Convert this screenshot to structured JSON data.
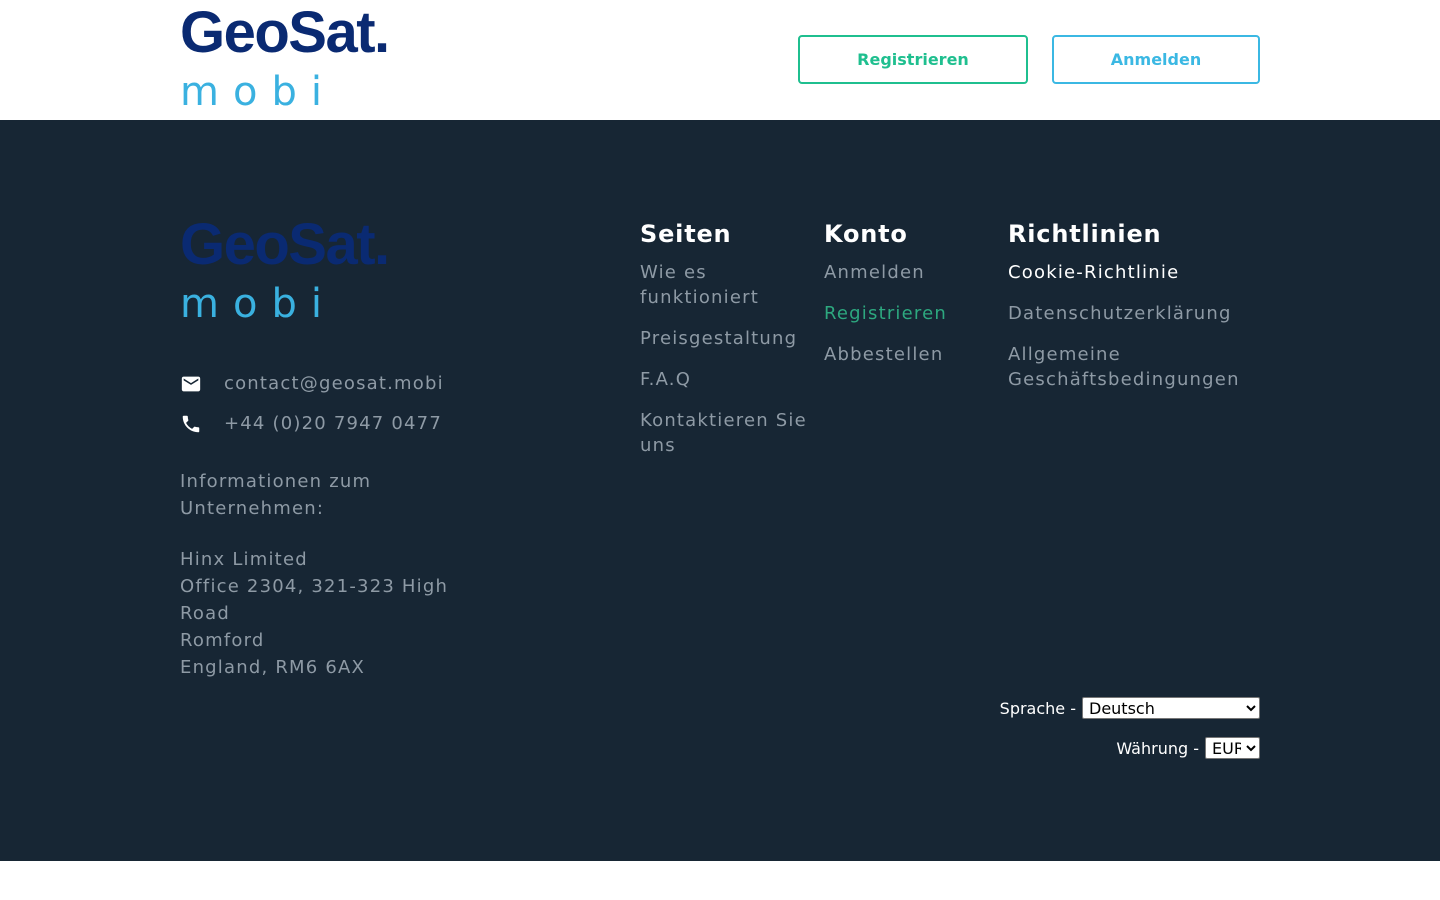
{
  "colors": {
    "footer_bg": "#172634",
    "logo_dark": "#0a2a72",
    "logo_light": "#3ab1e0",
    "accent_green": "#1fbf8f",
    "accent_cyan": "#3bb8e3",
    "link_muted": "#8e9aa5",
    "link_active": "#2da87f",
    "heading": "#ffffff"
  },
  "header": {
    "logo": {
      "word": "GeoSat.",
      "sub": "mobi"
    },
    "register_label": "Registrieren",
    "login_label": "Anmelden"
  },
  "footer": {
    "logo": {
      "word": "GeoSat.",
      "sub": "mobi"
    },
    "contact": {
      "email": "contact@geosat.mobi",
      "email_icon": "mail-icon",
      "phone": "+44 (0)20 7947 0477",
      "phone_icon": "phone-icon"
    },
    "company": {
      "title_line1": "Informationen zum",
      "title_line2": "Unternehmen:",
      "name": "Hinx Limited",
      "addr1": "Office 2304, 321-323 High",
      "addr2": "Road",
      "city": "Romford",
      "country": "England, RM6 6AX"
    },
    "columns": {
      "seiten": {
        "title": "Seiten",
        "items": [
          "Wie es funktioniert",
          "Preisgestaltung",
          "F.A.Q",
          "Kontaktieren Sie uns"
        ]
      },
      "konto": {
        "title": "Konto",
        "items": [
          "Anmelden",
          "Registrieren",
          "Abbestellen"
        ]
      },
      "richtlinien": {
        "title": "Richtlinien",
        "items": [
          "Cookie-Richtlinie",
          "Datenschutzerklärung",
          "Allgemeine Geschäftsbedingungen"
        ]
      }
    },
    "language": {
      "label": "Sprache -",
      "selected": "Deutsch"
    },
    "currency": {
      "label": "Währung -",
      "selected": "EUR"
    }
  }
}
